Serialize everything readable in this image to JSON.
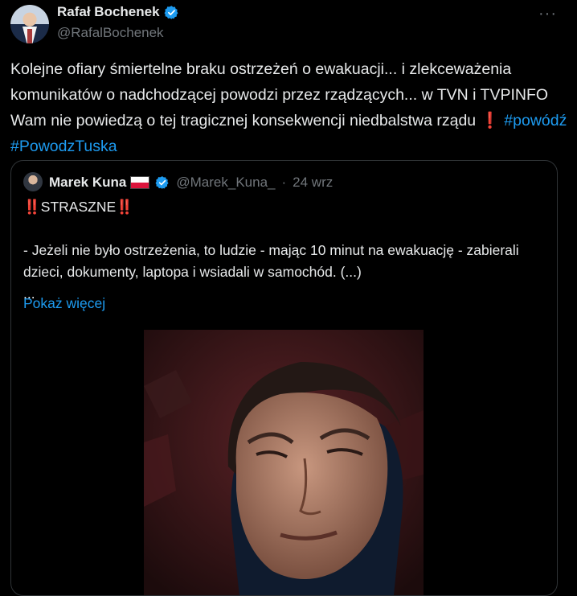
{
  "post": {
    "author_name": "Rafał Bochenek",
    "author_handle": "@RafalBochenek",
    "more_icon": "more-horizontal-icon",
    "text_plain": "Kolejne ofiary śmiertelne braku ostrzeżeń o ewakuacji... i zlekceważenia komunikatów o nadchodzącej powodzi przez rządzących...  w TVN i TVPINFO Wam nie powiedzą o tej tragicznej konsekwencji niedbalstwa rządu",
    "exclamation": "❗",
    "hashtags": [
      "#powódź",
      "#PowodzTuska"
    ]
  },
  "quote": {
    "author_name": "Marek Kuna",
    "author_handle": "@Marek_Kuna_",
    "separator": "·",
    "date": "24 wrz",
    "headline_prefix": "‼️",
    "headline": "STRASZNE",
    "headline_suffix": "‼️",
    "line1": "- Jeżeli nie było ostrzeżenia, to ludzie - mając 10 minut na ewakuację - zabierali",
    "line2": "dzieci, dokumenty, laptopa i wsiadali w samochód. (...)",
    "ellipsis": "...",
    "show_more": "Pokaż więcej"
  },
  "colors": {
    "background": "#000000",
    "text": "#e7e9ea",
    "secondary": "#71767b",
    "link": "#1d9bf0",
    "border": "#2f3336"
  }
}
